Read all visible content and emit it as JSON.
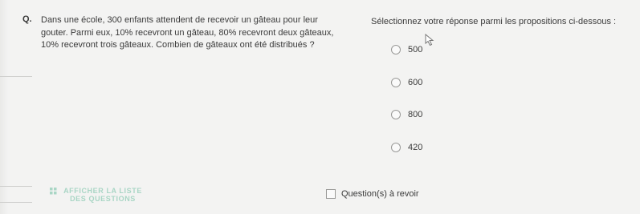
{
  "question": {
    "label": "Q.",
    "text": "Dans une école, 300 enfants attendent de recevoir un gâteau pour leur gouter. Parmi eux, 10% recevront un gâteau, 80% recevront deux gâteaux, 10% recevront trois gâteaux. Combien de gâteaux ont été distribués ?"
  },
  "answer_panel": {
    "instructions": "Sélectionnez votre réponse parmi les propositions ci-dessous :",
    "options": [
      {
        "label": "500"
      },
      {
        "label": "600"
      },
      {
        "label": "800"
      },
      {
        "label": "420"
      }
    ]
  },
  "footer": {
    "list_button_label": "AFFICHER LA LISTE DES QUESTIONS",
    "list_button_color": "#a9d6c5",
    "review_label": "Question(s) à revoir"
  },
  "icons": {
    "grid": "grid-icon",
    "cursor": "mouse-cursor-icon"
  }
}
